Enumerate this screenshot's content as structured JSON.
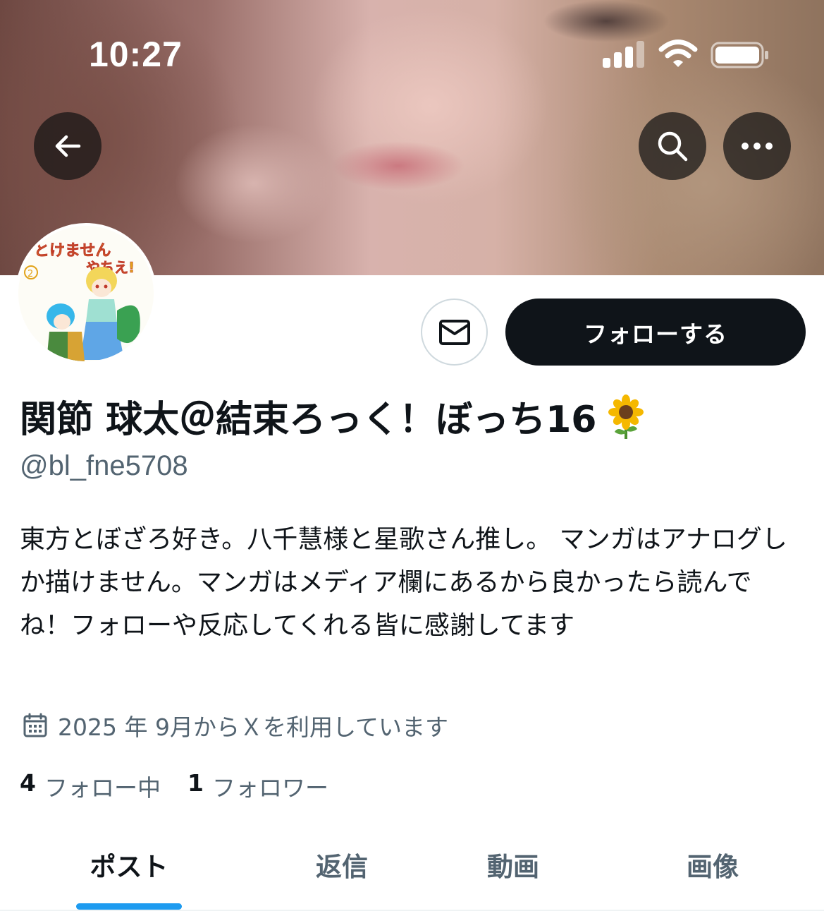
{
  "status_bar": {
    "time": "10:27"
  },
  "header": {
    "back_icon": "arrow-left-icon",
    "search_icon": "search-icon",
    "more_icon": "ellipsis-icon"
  },
  "profile": {
    "display_name": "関節 球太＠結束ろっく！ぼっち16",
    "name_emoji": "🌻",
    "handle": "@bl_fne5708",
    "bio": "東方とぼざろ好き。八千慧様と星歌さん推し。 マンガはアナログしか描けません。マンガはメディア欄にあるから良かったら読んでね！フォローや反応してくれる皆に感謝してます",
    "joined": "2025 年 9月からＸを利用しています",
    "avatar_text": "やれとけません やちえ!",
    "avatar_badge": "②",
    "following_count": "4",
    "following_label": "フォロー中",
    "followers_count": "1",
    "followers_label": "フォロワー"
  },
  "actions": {
    "message_icon": "envelope-icon",
    "follow_label": "フォローする"
  },
  "tabs": [
    {
      "label": "ポスト",
      "active": true
    },
    {
      "label": "返信",
      "active": false
    },
    {
      "label": "動画",
      "active": false
    },
    {
      "label": "画像",
      "active": false
    }
  ],
  "colors": {
    "accent": "#1d9bf0",
    "primary_text": "#0f1419",
    "secondary_text": "#536471",
    "button_dark": "#0f1419"
  }
}
